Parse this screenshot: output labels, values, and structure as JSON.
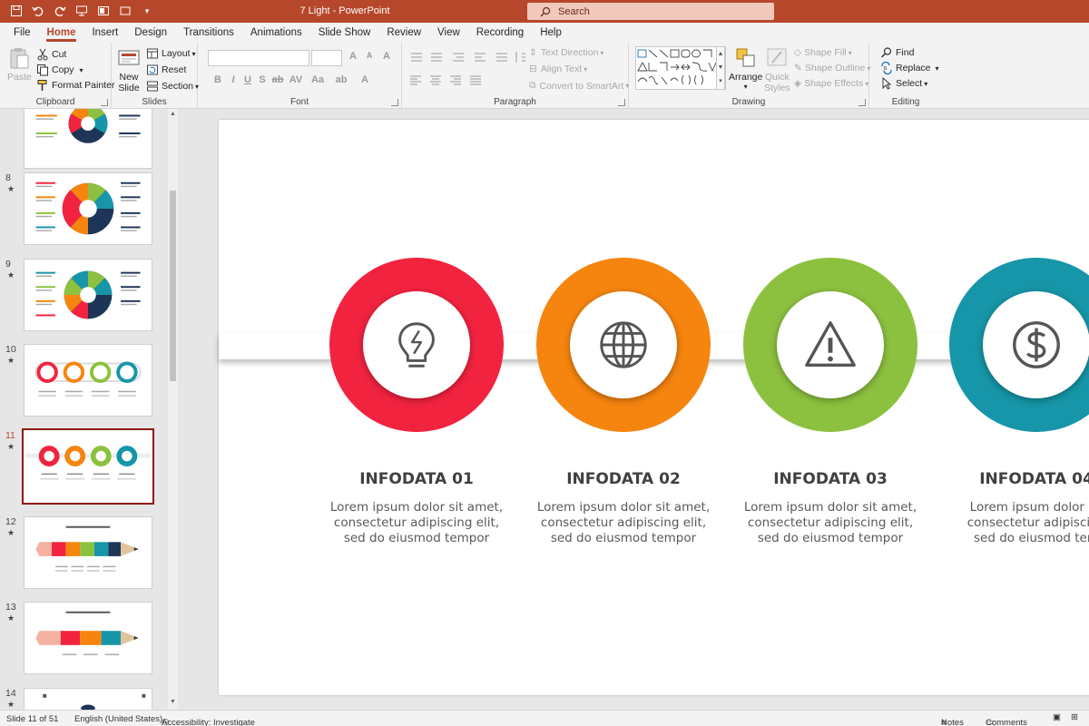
{
  "window": {
    "title": "7 Light  -  PowerPoint"
  },
  "search": {
    "placeholder": "Search"
  },
  "tabs": [
    "File",
    "Home",
    "Insert",
    "Design",
    "Transitions",
    "Animations",
    "Slide Show",
    "Review",
    "View",
    "Recording",
    "Help"
  ],
  "ribbon": {
    "clipboard": {
      "label": "Clipboard",
      "paste": "Paste",
      "cut": "Cut",
      "copy": "Copy",
      "format_painter": "Format Painter"
    },
    "slides": {
      "label": "Slides",
      "new_slide_line1": "New",
      "new_slide_line2": "Slide",
      "layout": "Layout",
      "reset": "Reset",
      "section": "Section"
    },
    "font": {
      "label": "Font"
    },
    "paragraph": {
      "label": "Paragraph",
      "text_direction": "Text Direction",
      "align_text": "Align Text",
      "convert_smartart": "Convert to SmartArt"
    },
    "drawing": {
      "label": "Drawing",
      "arrange": "Arrange",
      "quick_styles_line1": "Quick",
      "quick_styles_line2": "Styles",
      "shape_fill": "Shape Fill",
      "shape_outline": "Shape Outline",
      "shape_effects": "Shape Effects"
    },
    "editing": {
      "label": "Editing",
      "find": "Find",
      "replace": "Replace",
      "select": "Select"
    }
  },
  "thumbnails": [
    {
      "number": "",
      "star": ""
    },
    {
      "number": "8",
      "star": "★"
    },
    {
      "number": "9",
      "star": "★"
    },
    {
      "number": "10",
      "star": "★"
    },
    {
      "number": "11",
      "star": "★"
    },
    {
      "number": "12",
      "star": "★"
    },
    {
      "number": "13",
      "star": "★"
    },
    {
      "number": "14",
      "star": "★"
    }
  ],
  "slide": {
    "items": [
      {
        "title": "INFODATA 01",
        "line1": "Lorem ipsum dolor sit amet,",
        "line2": "consectetur adipiscing elit,",
        "line3": "sed do eiusmod tempor",
        "color": "#f2233f",
        "icon": "lightbulb-icon"
      },
      {
        "title": "INFODATA 02",
        "line1": "Lorem ipsum dolor sit amet,",
        "line2": "consectetur adipiscing elit,",
        "line3": "sed do eiusmod tempor",
        "color": "#f6850f",
        "icon": "globe-icon"
      },
      {
        "title": "INFODATA 03",
        "line1": "Lorem ipsum dolor sit amet,",
        "line2": "consectetur adipiscing elit,",
        "line3": "sed do eiusmod tempor",
        "color": "#8cc13f",
        "icon": "warning-icon"
      },
      {
        "title": "INFODATA 04",
        "line1": "Lorem ipsum dolor sit",
        "line2": "consectetur adipiscing",
        "line3": "sed do eiusmod tem",
        "color": "#1696a8",
        "icon": "dollar-icon"
      }
    ]
  },
  "status": {
    "slide_counter": "Slide 11 of 51",
    "language": "English (United States)",
    "accessibility": "Accessibility: Investigate",
    "notes": "Notes",
    "comments": "Comments"
  },
  "colors": {
    "accent": "#b7472a",
    "red": "#f2233f",
    "orange": "#f6850f",
    "green": "#8cc13f",
    "teal": "#1696a8",
    "navy": "#1d3557"
  }
}
